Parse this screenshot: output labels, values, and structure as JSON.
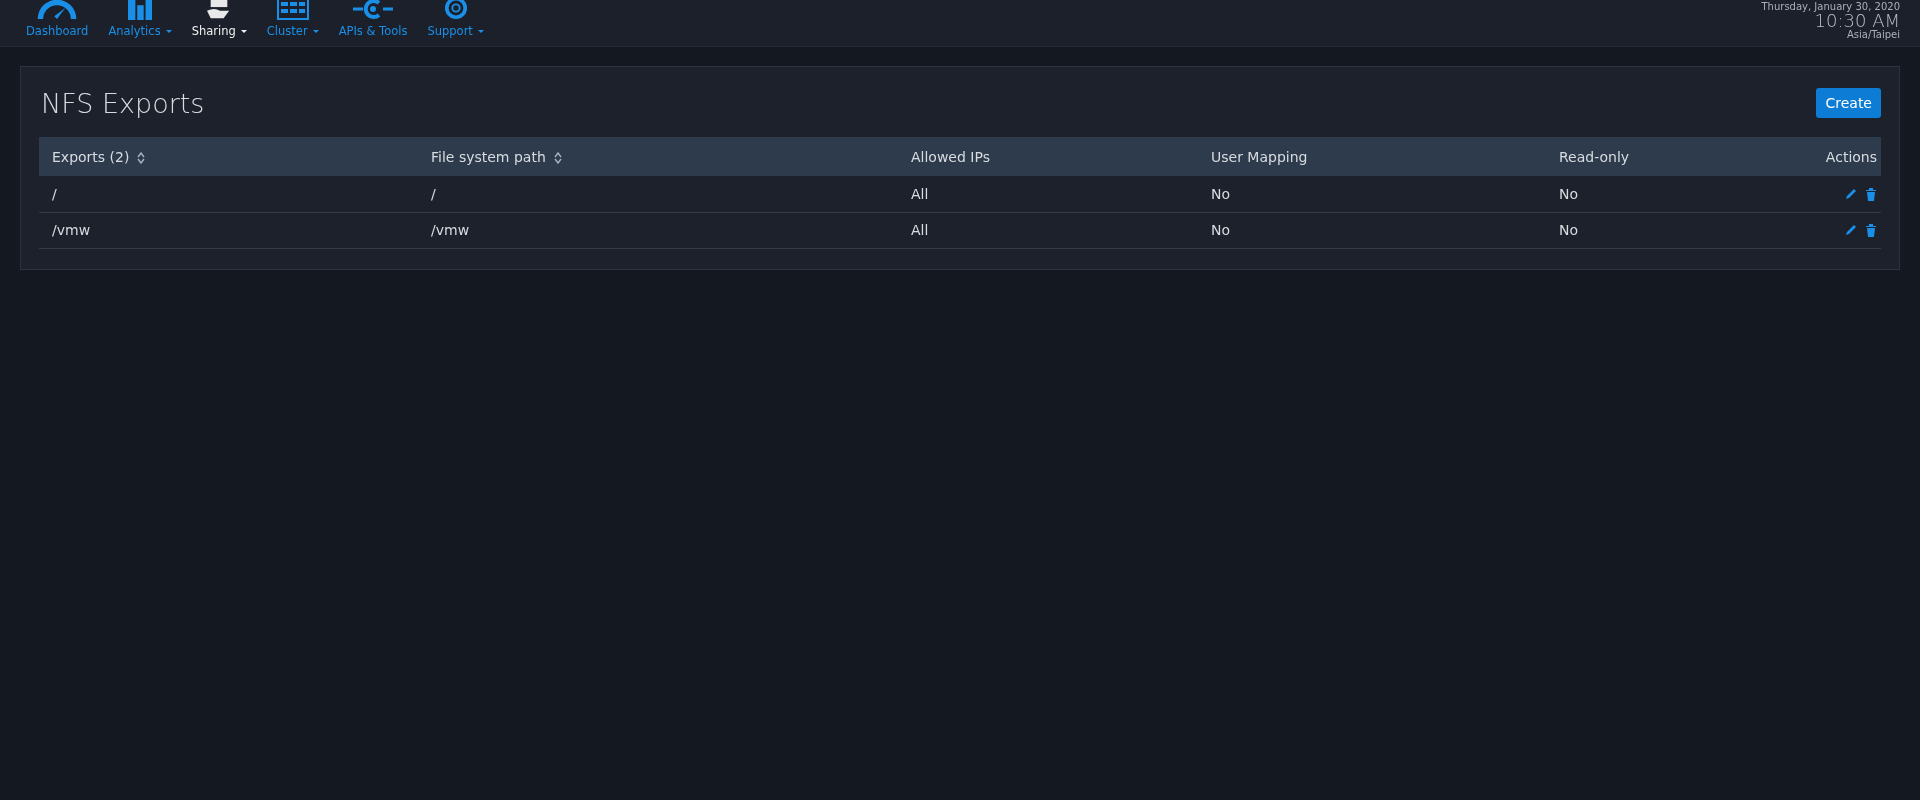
{
  "nav": {
    "items": [
      {
        "label": "Dashboard",
        "selected": false,
        "dropdown": false
      },
      {
        "label": "Analytics",
        "selected": false,
        "dropdown": true
      },
      {
        "label": "Sharing",
        "selected": true,
        "dropdown": true
      },
      {
        "label": "Cluster",
        "selected": false,
        "dropdown": true
      },
      {
        "label": "APIs & Tools",
        "selected": false,
        "dropdown": false
      },
      {
        "label": "Support",
        "selected": false,
        "dropdown": true
      }
    ],
    "clock": {
      "date": "Thursday, January 30, 2020",
      "time": "10:30 AM",
      "timezone": "Asia/Taipei"
    }
  },
  "panel": {
    "title": "NFS Exports",
    "create_button": "Create",
    "table": {
      "columns": [
        {
          "label": "Exports (2)",
          "sortable": true
        },
        {
          "label": "File system path",
          "sortable": true
        },
        {
          "label": "Allowed IPs",
          "sortable": false
        },
        {
          "label": "User Mapping",
          "sortable": false
        },
        {
          "label": "Read-only",
          "sortable": false
        },
        {
          "label": "Actions",
          "sortable": false
        }
      ],
      "rows": [
        [
          "/",
          "/",
          "All",
          "No",
          "No"
        ],
        [
          "/vmw",
          "/vmw",
          "All",
          "No",
          "No"
        ]
      ]
    }
  }
}
